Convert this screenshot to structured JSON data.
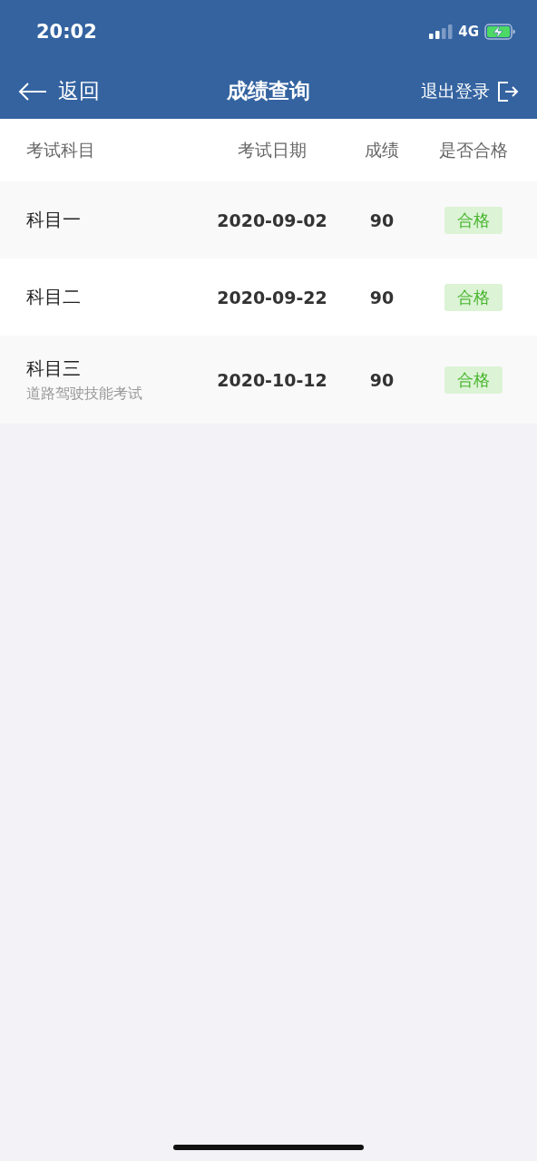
{
  "status_bar": {
    "time": "20:02",
    "network": "4G"
  },
  "nav": {
    "back": "返回",
    "title": "成绩查询",
    "logout": "退出登录"
  },
  "table": {
    "columns": [
      "考试科目",
      "考试日期",
      "成绩",
      "是否合格"
    ],
    "rows": [
      {
        "subject": "科目一",
        "date": "2020-09-02",
        "score": "90",
        "result": "合格",
        "passed": true
      },
      {
        "subject": "科目二",
        "date": "2020-09-22",
        "score": "90",
        "result": "合格",
        "passed": true
      },
      {
        "subject": "科目三",
        "note": "道路驾驶技能考试",
        "date": "2020-10-12",
        "score": "90",
        "result": "合格",
        "passed": true
      }
    ]
  }
}
